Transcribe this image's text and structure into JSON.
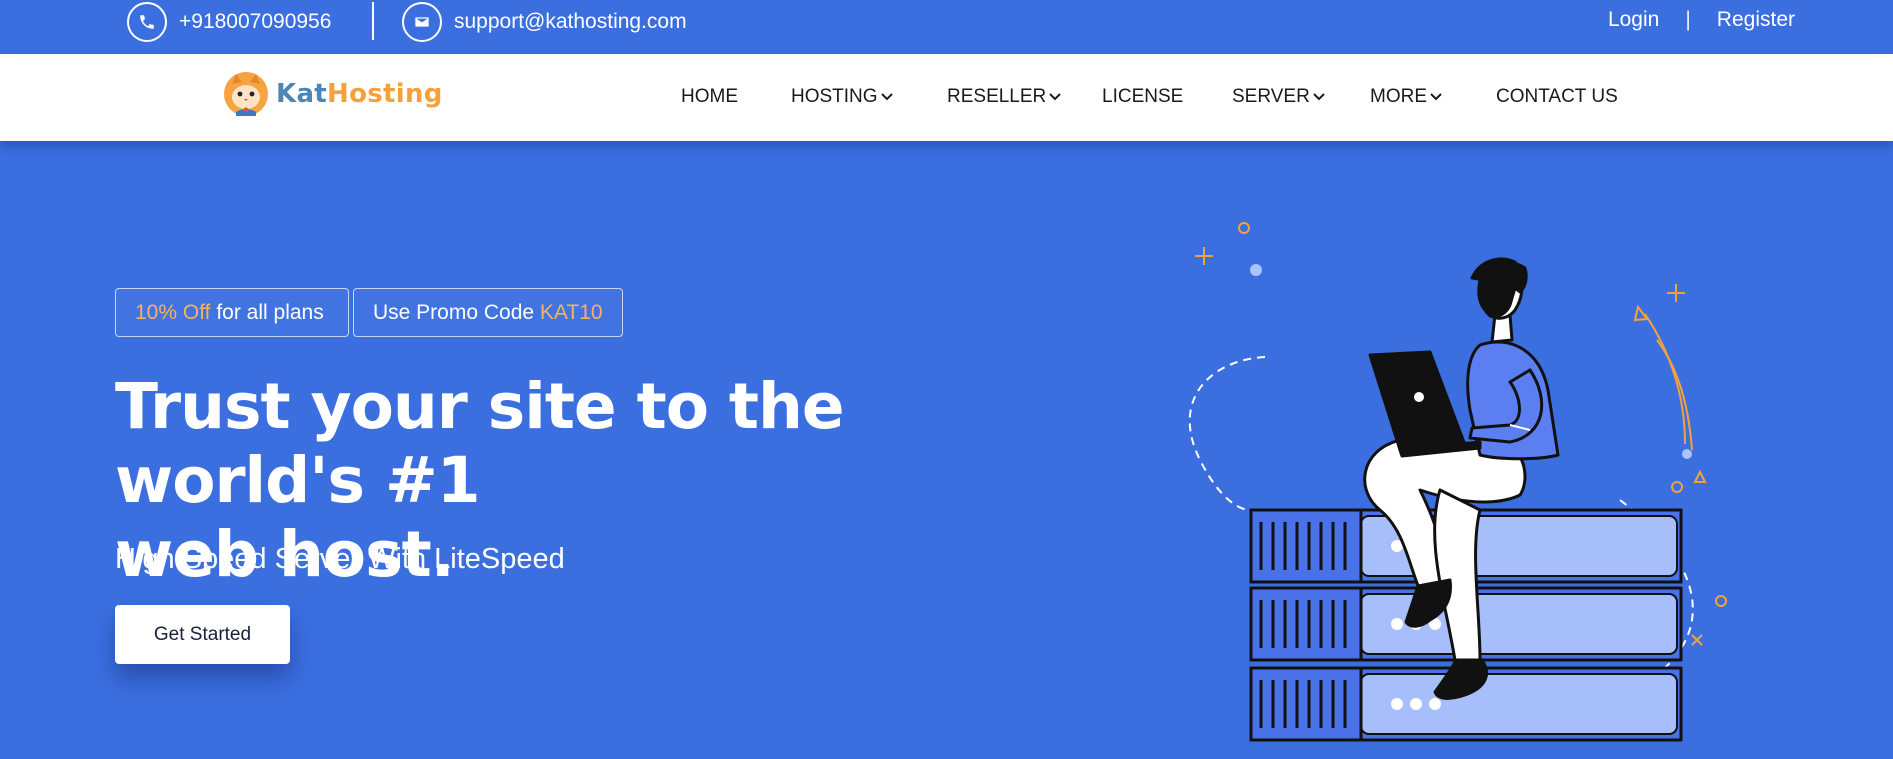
{
  "topbar": {
    "phone": "+918007090956",
    "email": "support@kathosting.com",
    "login": "Login",
    "separator": "|",
    "register": "Register"
  },
  "brand": {
    "part1": "Kat",
    "part2": "Hosting"
  },
  "nav": {
    "home": "HOME",
    "hosting": "HOSTING",
    "reseller": "RESELLER",
    "license": "LICENSE",
    "server": "SERVER",
    "more": "MORE",
    "contact": "CONTACT US"
  },
  "hero": {
    "promo1_highlight": "10% Off",
    "promo1_text": " for all plans",
    "promo2_text": "Use Promo Code ",
    "promo2_code": "KAT10",
    "headline_line1": "Trust your site to the world's #1",
    "headline_line2": "web host.",
    "subheadline": "High Speed Server With LiteSpeed",
    "cta_label": "Get Started"
  },
  "colors": {
    "primary": "#3b6fe0",
    "accent": "#f5a13a",
    "brand_blue": "#4b86b7",
    "server_panel": "#a6bffb"
  },
  "icons": [
    "phone-icon",
    "mail-icon",
    "chevron-down-icon",
    "cat-logo-icon"
  ]
}
